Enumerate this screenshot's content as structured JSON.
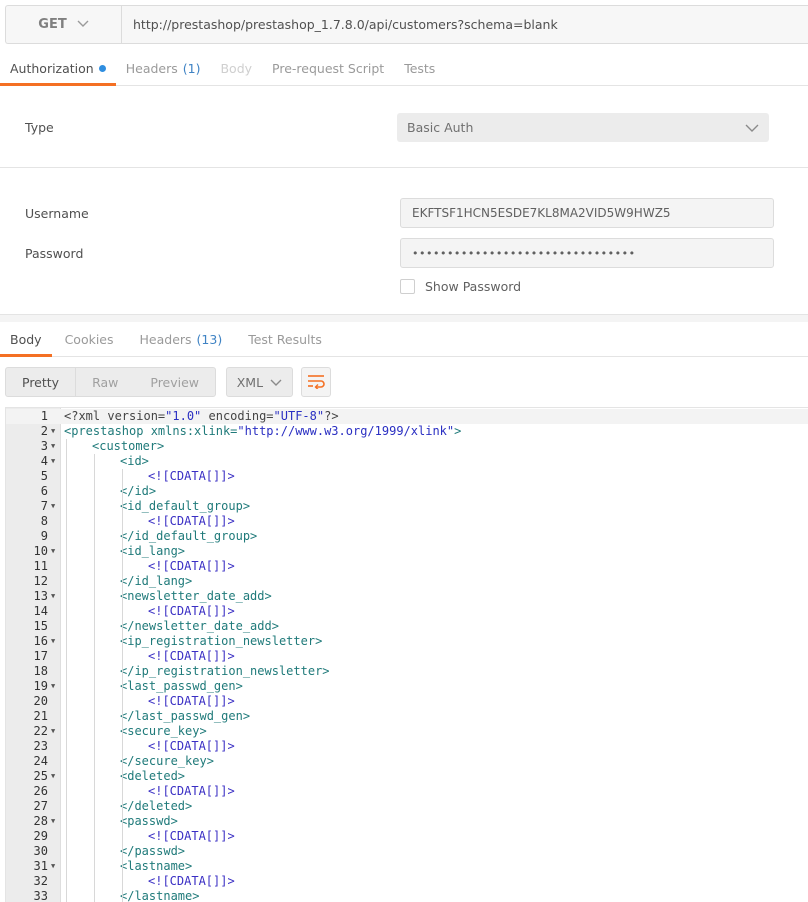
{
  "request": {
    "method": "GET",
    "url": "http://prestashop/prestashop_1.7.8.0/api/customers?schema=blank"
  },
  "request_tabs": [
    {
      "label": "Authorization",
      "count": "",
      "active": true,
      "dot": true
    },
    {
      "label": "Headers",
      "count": "(1)"
    },
    {
      "label": "Body",
      "count": "",
      "disabled": true
    },
    {
      "label": "Pre-request Script",
      "count": ""
    },
    {
      "label": "Tests",
      "count": ""
    }
  ],
  "auth": {
    "type_label": "Type",
    "type_value": "Basic Auth",
    "username_label": "Username",
    "username_value": "EKFTSF1HCN5ESDE7KL8MA2VID5W9HWZ5",
    "password_label": "Password",
    "password_value": "••••••••••••••••••••••••••••••••",
    "show_password_label": "Show Password"
  },
  "response_tabs": [
    {
      "label": "Body",
      "count": "",
      "active": true
    },
    {
      "label": "Cookies",
      "count": ""
    },
    {
      "label": "Headers",
      "count": "(13)"
    },
    {
      "label": "Test Results",
      "count": ""
    }
  ],
  "view": {
    "modes": [
      "Pretty",
      "Raw",
      "Preview"
    ],
    "format": "XML"
  },
  "code_lines": [
    {
      "n": "1",
      "fold": false,
      "indent": 0,
      "text": "<?xml version=\"1.0\" encoding=\"UTF-8\"?>",
      "kind": "pi"
    },
    {
      "n": "2",
      "fold": true,
      "indent": 0,
      "text": "<prestashop xmlns:xlink=\"http://www.w3.org/1999/xlink\">",
      "kind": "root"
    },
    {
      "n": "3",
      "fold": true,
      "indent": 1,
      "text": "<customer>",
      "kind": "tag"
    },
    {
      "n": "4",
      "fold": true,
      "indent": 2,
      "text": "<id>",
      "kind": "tag"
    },
    {
      "n": "5",
      "fold": false,
      "indent": 3,
      "text": "<![CDATA[]]>",
      "kind": "cdata"
    },
    {
      "n": "6",
      "fold": false,
      "indent": 2,
      "text": "</id>",
      "kind": "tag"
    },
    {
      "n": "7",
      "fold": true,
      "indent": 2,
      "text": "<id_default_group>",
      "kind": "tag"
    },
    {
      "n": "8",
      "fold": false,
      "indent": 3,
      "text": "<![CDATA[]]>",
      "kind": "cdata"
    },
    {
      "n": "9",
      "fold": false,
      "indent": 2,
      "text": "</id_default_group>",
      "kind": "tag"
    },
    {
      "n": "10",
      "fold": true,
      "indent": 2,
      "text": "<id_lang>",
      "kind": "tag"
    },
    {
      "n": "11",
      "fold": false,
      "indent": 3,
      "text": "<![CDATA[]]>",
      "kind": "cdata"
    },
    {
      "n": "12",
      "fold": false,
      "indent": 2,
      "text": "</id_lang>",
      "kind": "tag"
    },
    {
      "n": "13",
      "fold": true,
      "indent": 2,
      "text": "<newsletter_date_add>",
      "kind": "tag"
    },
    {
      "n": "14",
      "fold": false,
      "indent": 3,
      "text": "<![CDATA[]]>",
      "kind": "cdata"
    },
    {
      "n": "15",
      "fold": false,
      "indent": 2,
      "text": "</newsletter_date_add>",
      "kind": "tag"
    },
    {
      "n": "16",
      "fold": true,
      "indent": 2,
      "text": "<ip_registration_newsletter>",
      "kind": "tag"
    },
    {
      "n": "17",
      "fold": false,
      "indent": 3,
      "text": "<![CDATA[]]>",
      "kind": "cdata"
    },
    {
      "n": "18",
      "fold": false,
      "indent": 2,
      "text": "</ip_registration_newsletter>",
      "kind": "tag"
    },
    {
      "n": "19",
      "fold": true,
      "indent": 2,
      "text": "<last_passwd_gen>",
      "kind": "tag"
    },
    {
      "n": "20",
      "fold": false,
      "indent": 3,
      "text": "<![CDATA[]]>",
      "kind": "cdata"
    },
    {
      "n": "21",
      "fold": false,
      "indent": 2,
      "text": "</last_passwd_gen>",
      "kind": "tag"
    },
    {
      "n": "22",
      "fold": true,
      "indent": 2,
      "text": "<secure_key>",
      "kind": "tag"
    },
    {
      "n": "23",
      "fold": false,
      "indent": 3,
      "text": "<![CDATA[]]>",
      "kind": "cdata"
    },
    {
      "n": "24",
      "fold": false,
      "indent": 2,
      "text": "</secure_key>",
      "kind": "tag"
    },
    {
      "n": "25",
      "fold": true,
      "indent": 2,
      "text": "<deleted>",
      "kind": "tag"
    },
    {
      "n": "26",
      "fold": false,
      "indent": 3,
      "text": "<![CDATA[]]>",
      "kind": "cdata"
    },
    {
      "n": "27",
      "fold": false,
      "indent": 2,
      "text": "</deleted>",
      "kind": "tag"
    },
    {
      "n": "28",
      "fold": true,
      "indent": 2,
      "text": "<passwd>",
      "kind": "tag"
    },
    {
      "n": "29",
      "fold": false,
      "indent": 3,
      "text": "<![CDATA[]]>",
      "kind": "cdata"
    },
    {
      "n": "30",
      "fold": false,
      "indent": 2,
      "text": "</passwd>",
      "kind": "tag"
    },
    {
      "n": "31",
      "fold": true,
      "indent": 2,
      "text": "<lastname>",
      "kind": "tag"
    },
    {
      "n": "32",
      "fold": false,
      "indent": 3,
      "text": "<![CDATA[]]>",
      "kind": "cdata"
    },
    {
      "n": "33",
      "fold": false,
      "indent": 2,
      "text": "</lastname>",
      "kind": "tag"
    }
  ],
  "colors": {
    "accent": "#f47023",
    "count_blue": "#3f83c4",
    "dot_blue": "#2f8ee0"
  }
}
